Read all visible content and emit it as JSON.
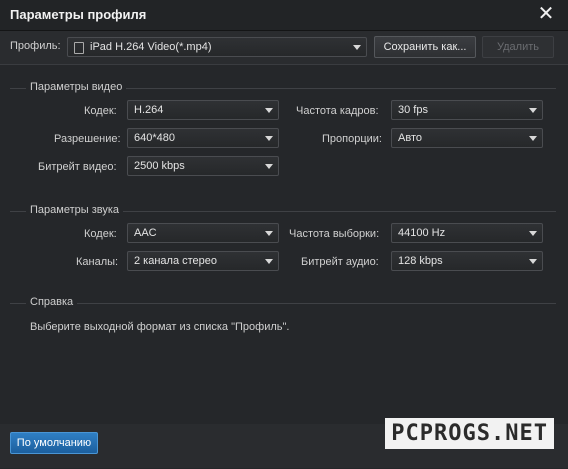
{
  "window": {
    "title": "Параметры профиля",
    "close_symbol": "✕"
  },
  "profile": {
    "label": "Профиль:",
    "value": "iPad H.264 Video(*.mp4)",
    "save_as": "Сохранить как...",
    "delete": "Удалить"
  },
  "video": {
    "section": "Параметры видео",
    "codec_label": "Кодек:",
    "codec_value": "H.264",
    "framerate_label": "Частота кадров:",
    "framerate_value": "30 fps",
    "resolution_label": "Разрешение:",
    "resolution_value": "640*480",
    "aspect_label": "Пропорции:",
    "aspect_value": "Авто",
    "bitrate_label": "Битрейт видео:",
    "bitrate_value": "2500 kbps"
  },
  "audio": {
    "section": "Параметры звука",
    "codec_label": "Кодек:",
    "codec_value": "AAC",
    "samplerate_label": "Частота выборки:",
    "samplerate_value": "44100 Hz",
    "channels_label": "Каналы:",
    "channels_value": "2 канала стерео",
    "bitrate_label": "Битрейт аудио:",
    "bitrate_value": "128 kbps"
  },
  "help": {
    "section": "Справка",
    "text": "Выберите выходной формат из списка \"Профиль\"."
  },
  "footer": {
    "default_button": "По умолчанию",
    "watermark": "PCPROGS.NET"
  },
  "colors": {
    "background": "#25272a",
    "accent": "#1c5f9e"
  }
}
